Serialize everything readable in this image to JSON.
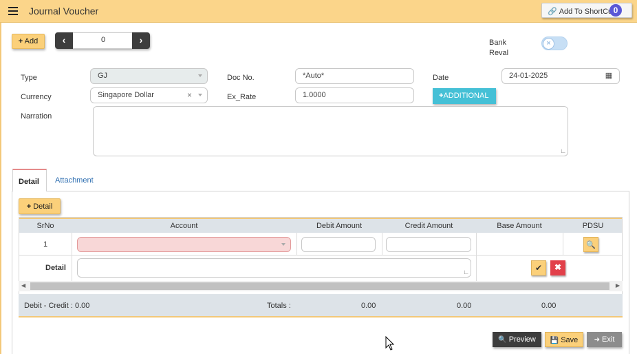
{
  "header": {
    "title": "Journal Voucher",
    "shortcut_label": "Add To ShortCut",
    "shortcut_badge": "0"
  },
  "toolbar": {
    "add_label": "Add",
    "nav_value": "0"
  },
  "bank_reval": {
    "label_line1": "Bank",
    "label_line2": "Reval",
    "enabled": false
  },
  "form": {
    "type_label": "Type",
    "type_value": "GJ",
    "docno_label": "Doc No.",
    "docno_value": "*Auto*",
    "date_label": "Date",
    "date_value": "24-01-2025",
    "currency_label": "Currency",
    "currency_value": "Singapore Dollar",
    "exrate_label": "Ex_Rate",
    "exrate_value": "1.0000",
    "additional_label": "ADDITIONAL",
    "narration_label": "Narration",
    "narration_value": ""
  },
  "tabs": [
    {
      "label": "Detail",
      "active": true
    },
    {
      "label": "Attachment",
      "active": false
    }
  ],
  "detail": {
    "add_detail_label": "Detail",
    "columns": [
      "SrNo",
      "Account",
      "Debit Amount",
      "Credit Amount",
      "Base Amount",
      "PDSU"
    ],
    "rows": [
      {
        "srno": "1",
        "account": "",
        "debit": "",
        "credit": "",
        "base": ""
      }
    ],
    "detail_row_label": "Detail"
  },
  "totals": {
    "debit_credit": "Debit - Credit : 0.00",
    "totals_label": "Totals :",
    "debit_total": "0.00",
    "credit_total": "0.00",
    "base_total": "0.00"
  },
  "footer": {
    "preview_label": "Preview",
    "save_label": "Save",
    "exit_label": "Exit"
  },
  "colors": {
    "header_bg": "#fbd58a",
    "accent_yellow": "#fbd07a",
    "additional_teal": "#45c0d6",
    "delete_red": "#e2404a",
    "badge_purple": "#5a57d6"
  }
}
